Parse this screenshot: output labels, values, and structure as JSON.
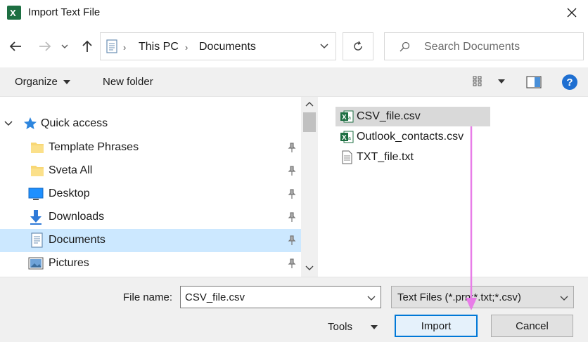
{
  "window": {
    "title": "Import Text File"
  },
  "address": {
    "crumbs": [
      "This PC",
      "Documents"
    ]
  },
  "search": {
    "placeholder": "Search Documents"
  },
  "commands": {
    "organize": "Organize",
    "new_folder": "New folder"
  },
  "nav": {
    "quick_access": "Quick access",
    "items": [
      {
        "label": "Template Phrases",
        "icon": "folder-icon"
      },
      {
        "label": "Sveta All",
        "icon": "folder-icon"
      },
      {
        "label": "Desktop",
        "icon": "desktop-icon"
      },
      {
        "label": "Downloads",
        "icon": "downloads-icon"
      },
      {
        "label": "Documents",
        "icon": "documents-icon"
      },
      {
        "label": "Pictures",
        "icon": "pictures-icon"
      }
    ]
  },
  "files": [
    {
      "name": "CSV_file.csv",
      "icon": "excel-csv-icon"
    },
    {
      "name": "Outlook_contacts.csv",
      "icon": "excel-csv-icon"
    },
    {
      "name": "TXT_file.txt",
      "icon": "text-file-icon"
    }
  ],
  "bottom": {
    "file_name_label": "File name:",
    "file_name_value": "CSV_file.csv",
    "file_type_value": "Text Files (*.prn;*.txt;*.csv)",
    "tools_label": "Tools",
    "import_label": "Import",
    "cancel_label": "Cancel"
  },
  "colors": {
    "selection": "#cce8ff",
    "accent": "#0078d7",
    "annotation_arrow": "#e87de8",
    "excel_green": "#1d6f42"
  }
}
